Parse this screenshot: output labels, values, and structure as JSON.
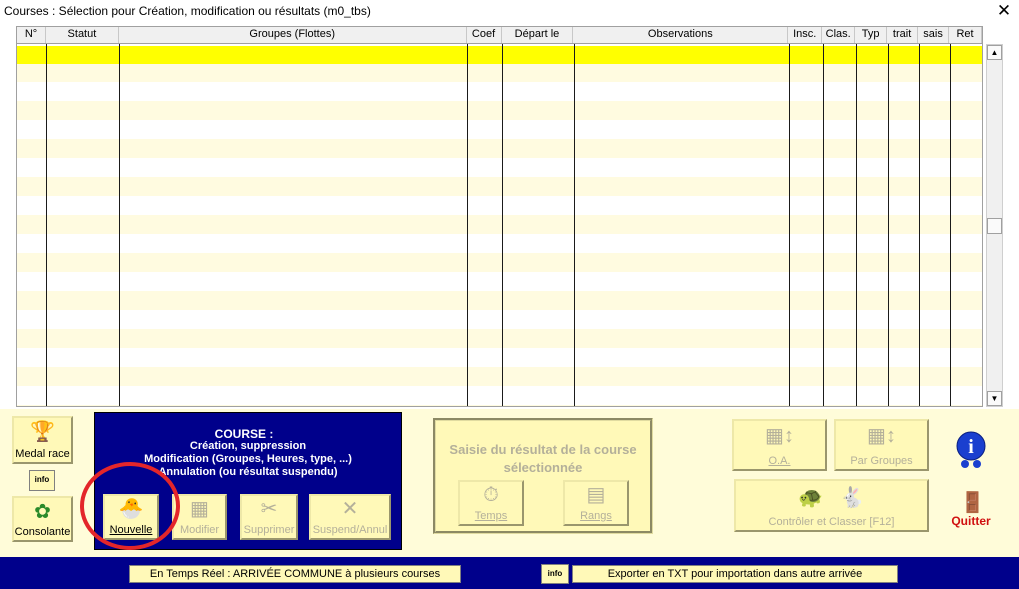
{
  "window": {
    "title": "Courses : Sélection pour Création, modification ou résultats    (m0_tbs)",
    "close": "✕"
  },
  "grid": {
    "columns": [
      "N°",
      "Statut",
      "Groupes (Flottes)",
      "Coef",
      "Départ le",
      "Observations",
      "Insc.",
      "Clas.",
      "Typ",
      "trait",
      "sais",
      "Ret"
    ],
    "selected_row": 1
  },
  "scroll": {
    "up": "▲",
    "down": "▼"
  },
  "left": {
    "medal": "Medal race",
    "info": "info",
    "consolante": "Consolante"
  },
  "course": {
    "title": "COURSE :",
    "line1": "Création, suppression",
    "line2": "Modification (Groupes, Heures, type, ...)",
    "line3": "Annulation (ou résultat suspendu)"
  },
  "actions": {
    "nouvelle": "Nouvelle",
    "modifier": "Modifier",
    "supprimer": "Supprimer",
    "suspend": "Suspend/Annul"
  },
  "saisie": {
    "title": "Saisie du résultat de la course sélectionnée",
    "temps": "Temps",
    "rangs": "Rangs"
  },
  "right": {
    "oa": "O.A.",
    "par_groupes": "Par Groupes",
    "controler": "Contrôler et Classer [F12]",
    "quitter": "Quitter"
  },
  "status": {
    "temps_reel": "En Temps Réel : ARRIVÉE COMMUNE à plusieurs courses",
    "info": "info",
    "exporter": "Exporter  en TXT pour importation dans  autre arrivée"
  },
  "colors": {
    "selection": "#ffff00",
    "panel": "#00008b",
    "button": "#fff9b8",
    "highlight_circle": "#e3262a"
  }
}
